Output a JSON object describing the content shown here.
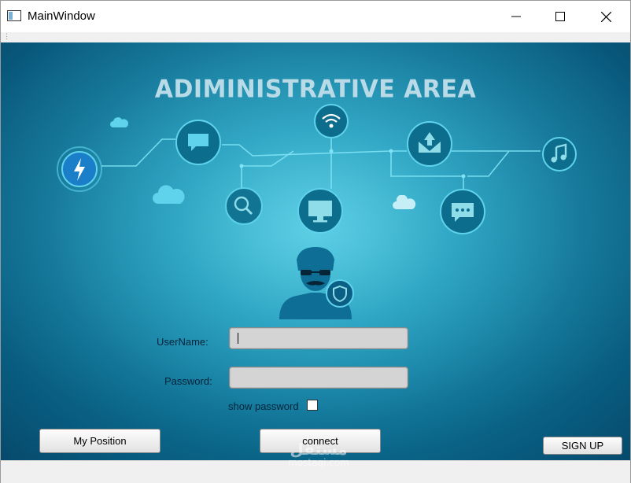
{
  "window": {
    "title": "MainWindow",
    "minimize_icon": "minimize-icon",
    "maximize_icon": "maximize-icon",
    "close_icon": "close-icon"
  },
  "hero": {
    "headline": "ADIMINISTRATIVE AREA",
    "icons": [
      "lightning-icon",
      "chat-icon",
      "wifi-icon",
      "inbox-icon",
      "music-icon",
      "search-icon",
      "monitor-icon",
      "message-dots-icon",
      "cloud-icon",
      "admin-avatar-icon",
      "shield-icon"
    ]
  },
  "form": {
    "username_label": "UserName:",
    "username_value": "",
    "password_label": "Password:",
    "password_value": "",
    "show_password_label": "show password",
    "show_password_checked": false
  },
  "buttons": {
    "my_position": "My Position",
    "connect": "connect",
    "sign_up": "SIGN UP"
  },
  "watermark": {
    "arabic": "مستقل",
    "latin": "mostaqi.com"
  },
  "colors": {
    "accent_cyan": "#5fd3ec",
    "circuit_line": "#7fe3f5",
    "headline": "#b9dbe8"
  }
}
